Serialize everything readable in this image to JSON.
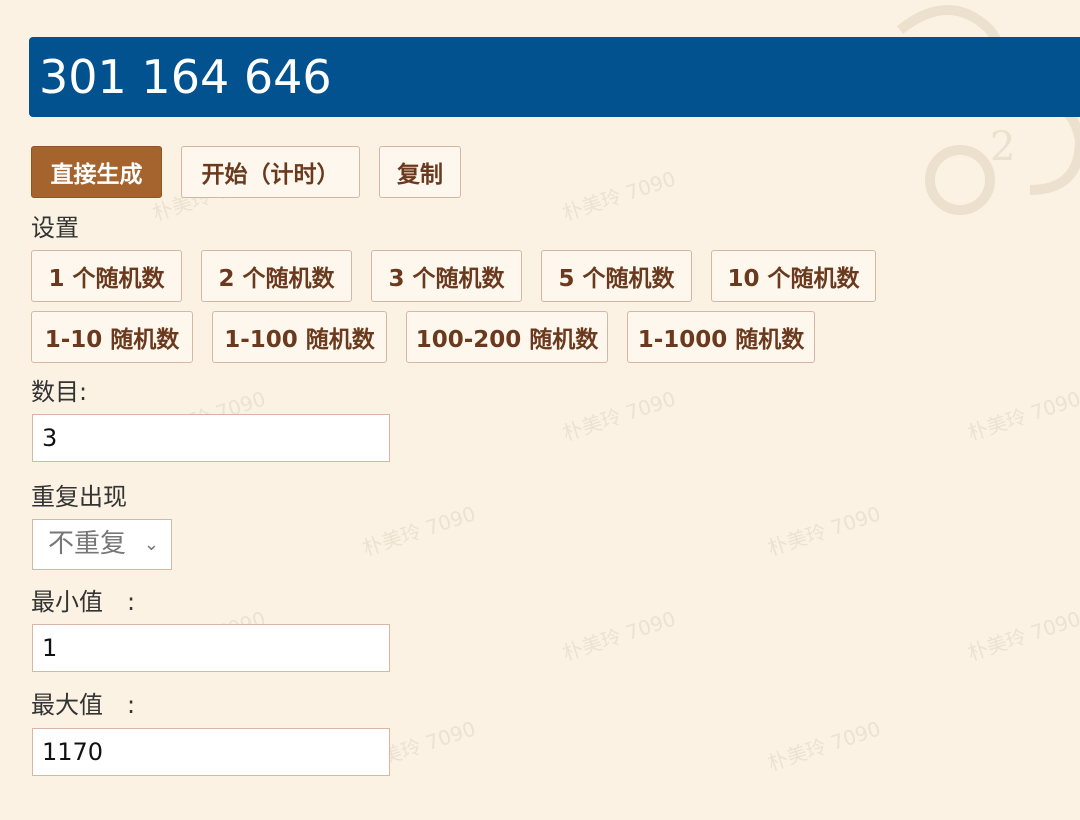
{
  "result": "301 164 646",
  "actions": {
    "generate": "直接生成",
    "start_timer": "开始（计时）",
    "copy": "复制"
  },
  "settings_label": "设置",
  "presets_count": [
    "1 个随机数",
    "2 个随机数",
    "3 个随机数",
    "5 个随机数",
    "10 个随机数"
  ],
  "presets_range": [
    "1-10 随机数",
    "1-100 随机数",
    "100-200 随机数",
    "1-1000 随机数"
  ],
  "count": {
    "label": "数目:",
    "value": "3"
  },
  "repeat": {
    "label": "重复出现",
    "value": "不重复"
  },
  "min": {
    "label": "最小值　:",
    "value": "1"
  },
  "max": {
    "label": "最大值　:",
    "value": "1170"
  },
  "watermark": "朴美玲 7090",
  "colors": {
    "result_bg": "#02528f",
    "primary_button": "#a5642e",
    "button_text": "#6b3a1e",
    "page_bg": "#fbf2e3"
  }
}
